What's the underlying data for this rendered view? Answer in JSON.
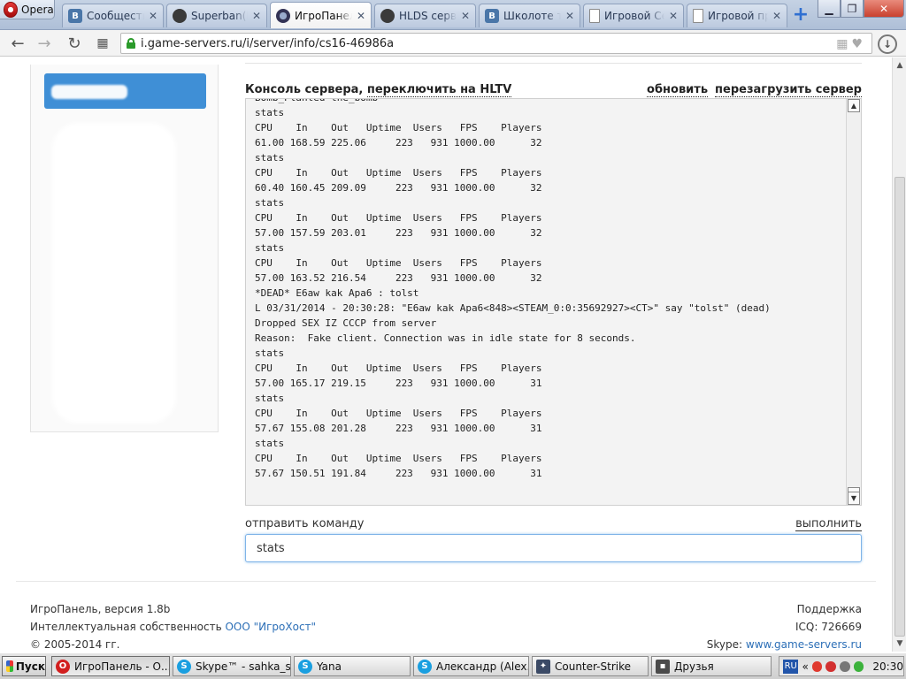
{
  "browser": {
    "menu_label": "Opera",
    "tabs": [
      {
        "title": "Сообщества",
        "icon": "vk-icon"
      },
      {
        "title": "Superban(h",
        "icon": "ninja-icon"
      },
      {
        "title": "ИгроПанель",
        "icon": "gamepanel-icon",
        "active": true
      },
      {
        "title": "HLDS серве",
        "icon": "ninja-icon"
      },
      {
        "title": "Школоте т",
        "icon": "vk-icon"
      },
      {
        "title": "Игровой Се",
        "icon": "page-icon"
      },
      {
        "title": "Игровой пр",
        "icon": "page-icon"
      }
    ],
    "new_tab": "+",
    "url": "i.game-servers.ru/i/server/info/cs16-46986a"
  },
  "console": {
    "title_prefix": "Консоль сервера, ",
    "title_link": "переключить на HLTV",
    "refresh": "обновить",
    "restart": "перезагрузить сервер",
    "text": "Bomb_Planted the_bomb\nstats\nCPU    In    Out   Uptime  Users   FPS    Players\n61.00 168.59 225.06     223   931 1000.00      32\nstats\nCPU    In    Out   Uptime  Users   FPS    Players\n60.40 160.45 209.09     223   931 1000.00      32\nstats\nCPU    In    Out   Uptime  Users   FPS    Players\n57.00 157.59 203.01     223   931 1000.00      32\nstats\nCPU    In    Out   Uptime  Users   FPS    Players\n57.00 163.52 216.54     223   931 1000.00      32\n*DEAD* E6aw kak Apa6 : tolst\nL 03/31/2014 - 20:30:28: \"E6aw kak Apa6<848><STEAM_0:0:35692927><CT>\" say \"tolst\" (dead)\nDropped SEX IZ CCCP from server\nReason:  Fake client. Connection was in idle state for 8 seconds.\nstats\nCPU    In    Out   Uptime  Users   FPS    Players\n57.00 165.17 219.15     223   931 1000.00      31\nstats\nCPU    In    Out   Uptime  Users   FPS    Players\n57.67 155.08 201.28     223   931 1000.00      31\nstats\nCPU    In    Out   Uptime  Users   FPS    Players\n57.67 150.51 191.84     223   931 1000.00      31"
  },
  "command": {
    "label": "отправить команду",
    "run": "выполнить",
    "value": "stats"
  },
  "footer": {
    "version": "ИгроПанель, версия 1.8b",
    "ip_prefix": "Интеллектуальная собственность ",
    "ip_company": "ООО \"ИгроХост\"",
    "copyright": "© 2005-2014 гг.",
    "support": "Поддержка",
    "icq": "ICQ: 726669",
    "skype_prefix": "Skype: ",
    "skype_site": "www.game-servers.ru"
  },
  "taskbar": {
    "start": "Пуск",
    "items": [
      {
        "label": "ИгроПанель - О...",
        "icon": "opera-icon",
        "active": true
      },
      {
        "label": "Skype™ - sahka_svet",
        "icon": "skype-icon"
      },
      {
        "label": "Yana",
        "icon": "skype-icon"
      },
      {
        "label": "Александр  (Alex...",
        "icon": "skype-icon"
      },
      {
        "label": "Counter-Strike",
        "icon": "cs-icon"
      },
      {
        "label": "Друзья",
        "icon": "friends-icon"
      }
    ],
    "lang": "RU",
    "clock": "20:30"
  },
  "colors": {
    "accent": "#3f8fd6",
    "link": "#2c6fb7"
  }
}
